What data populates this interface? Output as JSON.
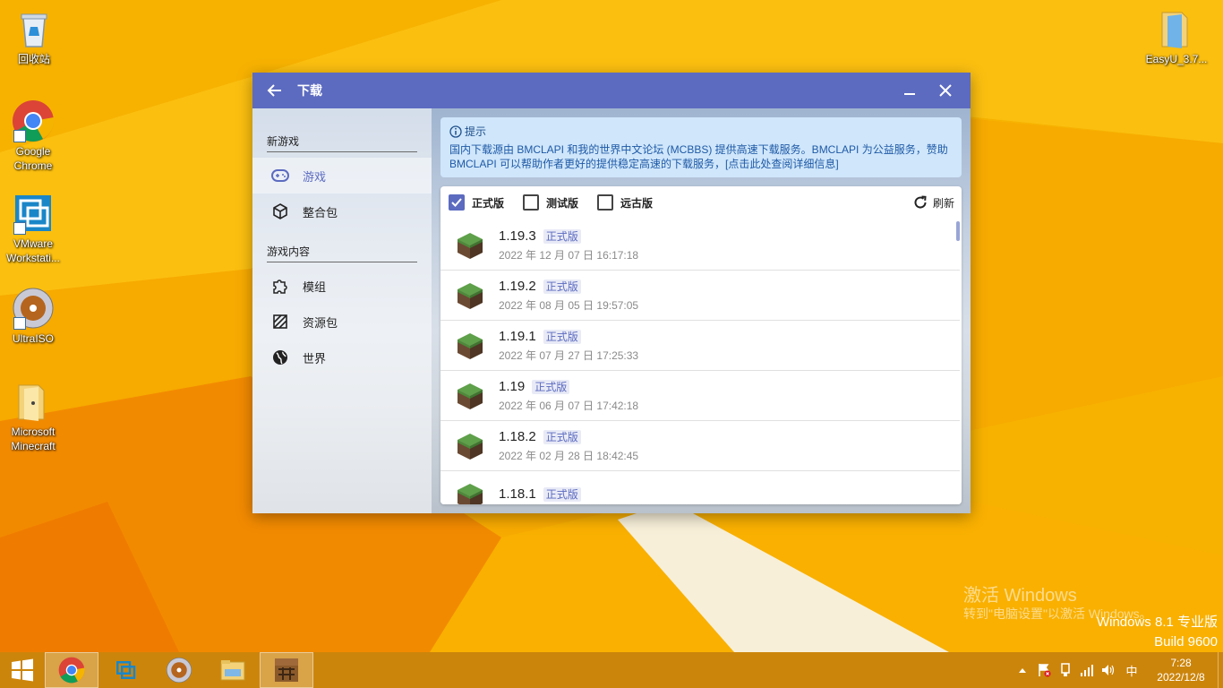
{
  "desktop": {
    "icons": [
      {
        "label": "回收站"
      },
      {
        "label": "Google Chrome"
      },
      {
        "label": "VMware Workstati..."
      },
      {
        "label": "UltraISO"
      },
      {
        "label": "Microsoft Minecraft"
      },
      {
        "label": "EasyU_3.7..."
      }
    ]
  },
  "window": {
    "title": "下载",
    "sidebar": {
      "section1": "新游戏",
      "items1": [
        {
          "label": "游戏",
          "icon": "gamepad-icon"
        },
        {
          "label": "整合包",
          "icon": "package-icon"
        }
      ],
      "section2": "游戏内容",
      "items2": [
        {
          "label": "模组",
          "icon": "puzzle-icon"
        },
        {
          "label": "资源包",
          "icon": "texture-icon"
        },
        {
          "label": "世界",
          "icon": "globe-icon"
        }
      ]
    },
    "hint": {
      "title": "提示",
      "text": "国内下载源由 BMCLAPI 和我的世界中文论坛 (MCBBS) 提供高速下载服务。BMCLAPI 为公益服务，赞助 BMCLAPI 可以帮助作者更好的提供稳定高速的下载服务，[点击此处查阅详细信息]"
    },
    "filters": {
      "release": "正式版",
      "snapshot": "测试版",
      "old": "远古版",
      "refresh": "刷新"
    },
    "versions": [
      {
        "version": "1.19.3",
        "tag": "正式版",
        "date": "2022 年 12 月 07 日 16:17:18"
      },
      {
        "version": "1.19.2",
        "tag": "正式版",
        "date": "2022 年 08 月 05 日 19:57:05"
      },
      {
        "version": "1.19.1",
        "tag": "正式版",
        "date": "2022 年 07 月 27 日 17:25:33"
      },
      {
        "version": "1.19",
        "tag": "正式版",
        "date": "2022 年 06 月 07 日 17:42:18"
      },
      {
        "version": "1.18.2",
        "tag": "正式版",
        "date": "2022 年 02 月 28 日 18:42:45"
      },
      {
        "version": "1.18.1",
        "tag": "正式版",
        "date": ""
      }
    ]
  },
  "watermark": {
    "line1": "激活 Windows",
    "line2": "转到\"电脑设置\"以激活 Windows。",
    "edition": "Windows 8.1 专业版",
    "build": "Build 9600"
  },
  "taskbar": {
    "ime": "中",
    "time": "7:28",
    "date": "2022/12/8"
  },
  "colors": {
    "accent": "#5c6bc0",
    "hint_bg": "#cfe6fb",
    "taskbar": "#c6800c"
  }
}
